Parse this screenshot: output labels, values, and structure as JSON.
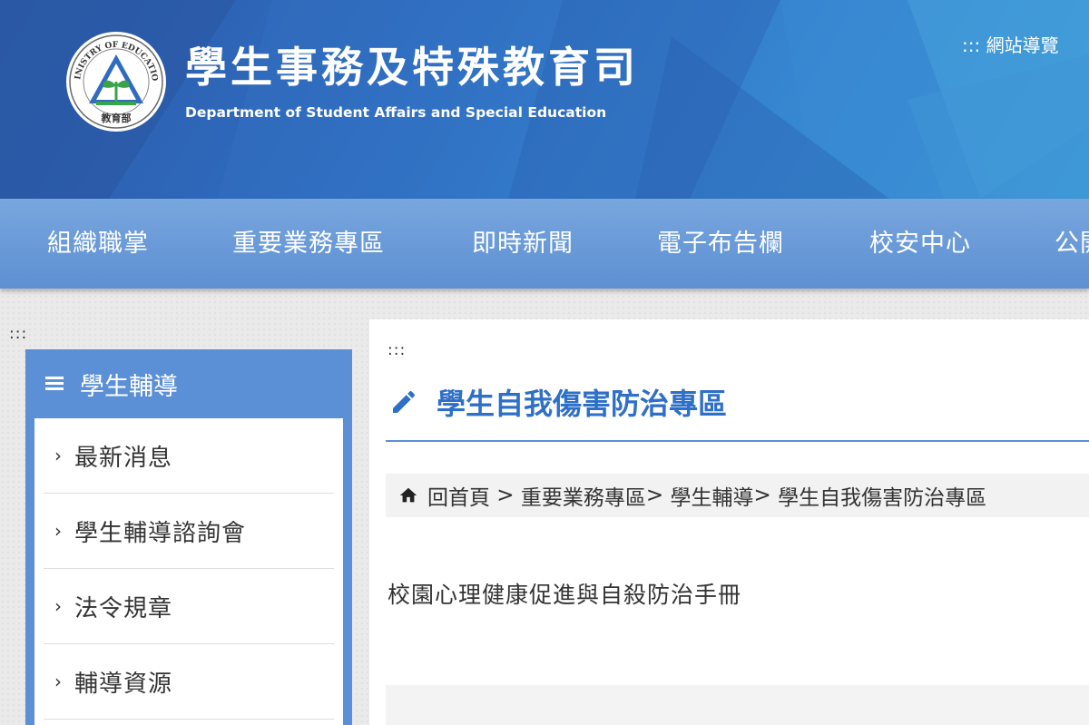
{
  "header": {
    "logo_text_top": "MINISTRY OF EDUCATION",
    "logo_text_bottom": "教育部",
    "title_zh": "學生事務及特殊教育司",
    "title_en": "Department of Student Affairs and Special Education",
    "sitemap_label": "::: 網站導覽"
  },
  "nav": {
    "items": [
      "組織職掌",
      "重要業務專區",
      "即時新聞",
      "電子布告欄",
      "校安中心",
      "公開"
    ]
  },
  "accesskeys": {
    "left": ":::",
    "center": ":::"
  },
  "sidebar": {
    "heading": "學生輔導",
    "items": [
      "最新消息",
      "學生輔導諮詢會",
      "法令規章",
      "輔導資源"
    ]
  },
  "content": {
    "title": "學生自我傷害防治專區",
    "breadcrumb": {
      "home": "回首頁",
      "sep1": " > ",
      "crumb1": "重要業務專區",
      "sep2": "> ",
      "crumb2": "學生輔導",
      "sep3": "> ",
      "crumb3": "學生自我傷害防治專區"
    },
    "doc_link": "校園心理健康促進與自殺防治手冊"
  },
  "colors": {
    "header_blue": "#2f6cc0",
    "nav_blue": "#6a9ad8",
    "sidebar_blue": "#5b8fd6",
    "title_blue": "#2e6fc8"
  },
  "icons": [
    "moe-logo-icon",
    "hamburger-icon",
    "chevron-right-icon",
    "pencil-icon",
    "home-icon"
  ]
}
